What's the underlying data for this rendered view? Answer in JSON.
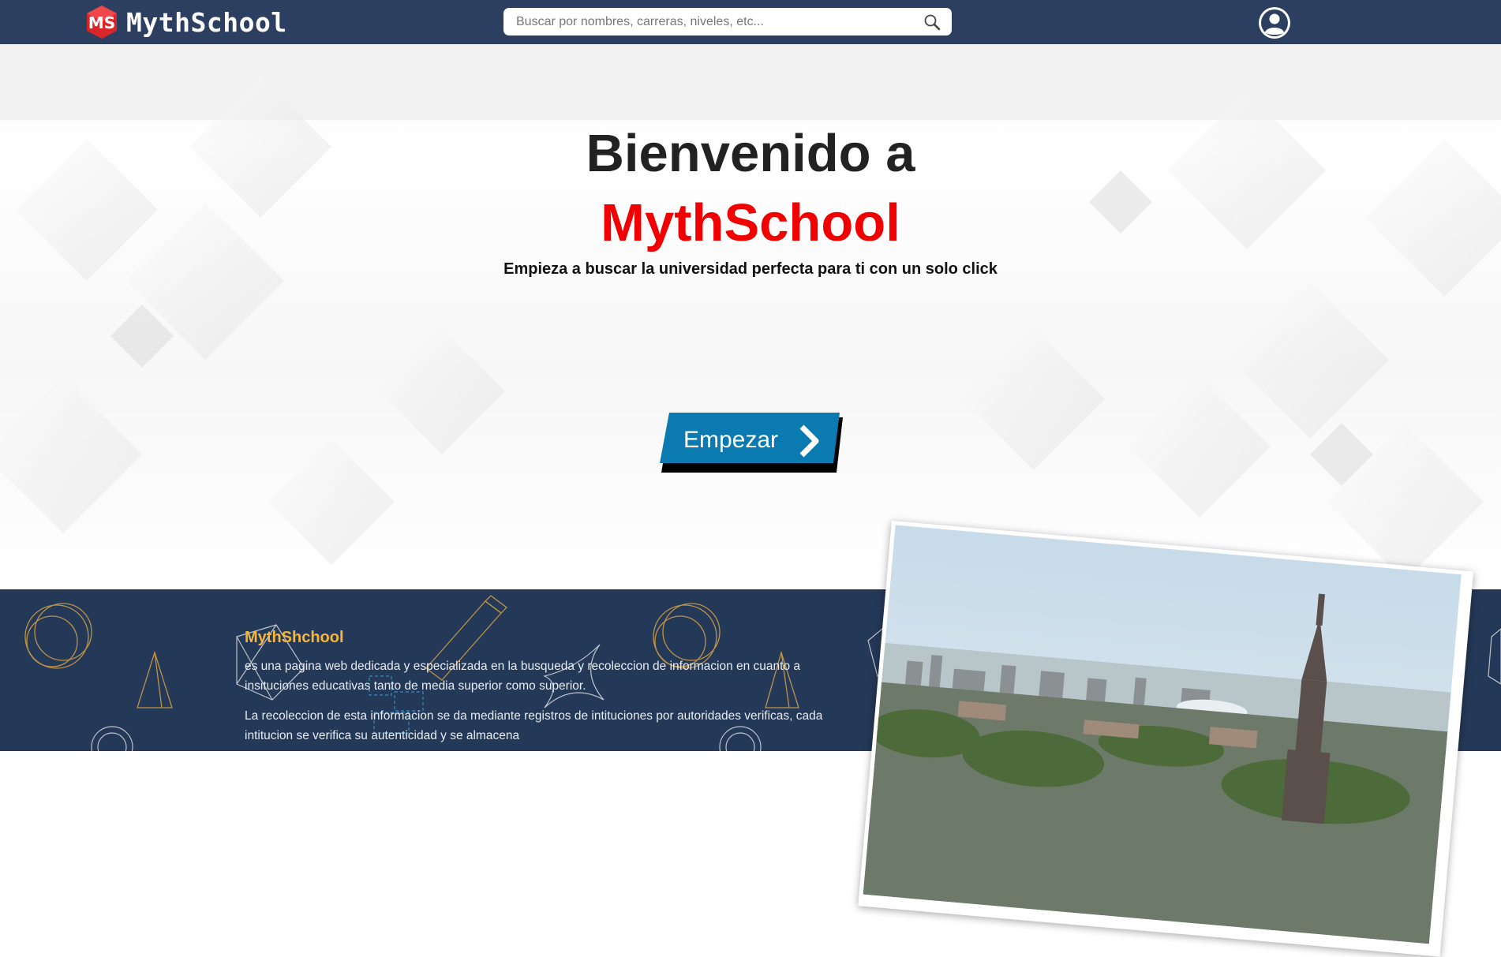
{
  "header": {
    "logo_text": "MythSchool",
    "logo_badge": "MS",
    "search_placeholder": "Buscar por nombres, carreras, niveles, etc...",
    "icons": {
      "search": "search-icon",
      "user": "user-avatar-icon"
    }
  },
  "hero": {
    "title": "Bienvenido a",
    "brand": "MythSchool",
    "subtitle": "Empieza a buscar la universidad perfecta para ti con un solo click",
    "cta_label": "Empezar",
    "cta_icon": "chevron-right-icon"
  },
  "info": {
    "title": "MythShchool",
    "paragraph1": "es una pagina web dedicada y especializada en la busqueda y recoleccion de informacion en cuanto a insituciones educativas tanto de media superior como superior.",
    "paragraph2": "La recoleccion de esta informacion se da mediante registros de intituciones por autoridades verificas, cada intitucion se verifica su autenticidad y se almacena"
  },
  "photo": {
    "subject": "university-cityscape-photo"
  },
  "colors": {
    "navbar": "#2c3f60",
    "brand_red": "#f00000",
    "cta_blue": "#0b7ab1",
    "info_bg": "#243858",
    "info_title": "#f5b63b"
  }
}
